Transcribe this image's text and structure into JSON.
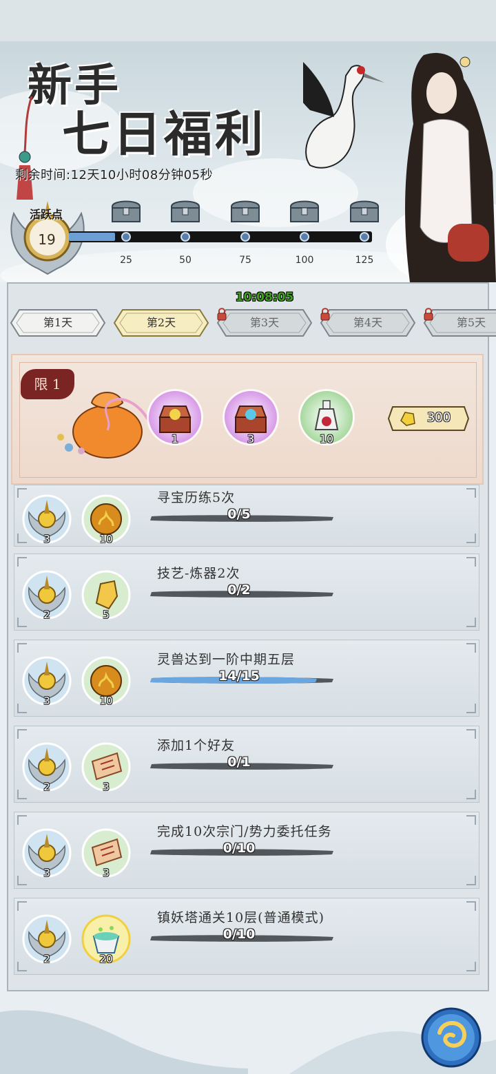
{
  "banner": {
    "title_line1": "新手",
    "title_line2": "七日福利",
    "remaining_time": "剩余时间:12天10小时08分钟05秒",
    "active_label": "活跃点",
    "active_value": "19",
    "progress_fraction": 0.152,
    "milestones": [
      "25",
      "50",
      "75",
      "100",
      "125"
    ]
  },
  "panel": {
    "countdown": "10:08:05",
    "day_tabs": [
      {
        "label": "第1天",
        "state": "normal"
      },
      {
        "label": "第2天",
        "state": "selected"
      },
      {
        "label": "第3天",
        "state": "locked"
      },
      {
        "label": "第4天",
        "state": "locked"
      },
      {
        "label": "第5天",
        "state": "locked"
      }
    ]
  },
  "gift": {
    "limit_label": "限 1",
    "rewards": [
      {
        "icon": "treasure-chest-gold-icon",
        "count": "1"
      },
      {
        "icon": "treasure-chest-blue-icon",
        "count": "3"
      },
      {
        "icon": "red-potion-bottle-icon",
        "count": "10"
      }
    ],
    "price": "300"
  },
  "tasks": [
    {
      "title": "寻宝历练5次",
      "progress": "0/5",
      "fraction": 0,
      "reward1_count": "3",
      "reward2_count": "10",
      "reward2_icon": "fire-orb-icon"
    },
    {
      "title": "技艺-炼器2次",
      "progress": "0/2",
      "fraction": 0,
      "reward1_count": "2",
      "reward2_count": "5",
      "reward2_icon": "gold-ore-icon"
    },
    {
      "title": "灵兽达到一阶中期五层",
      "progress": "14/15",
      "fraction": 0.933,
      "reward1_count": "3",
      "reward2_count": "10",
      "reward2_icon": "fire-orb-icon"
    },
    {
      "title": "添加1个好友",
      "progress": "0/1",
      "fraction": 0,
      "reward1_count": "2",
      "reward2_count": "3",
      "reward2_icon": "scroll-icon"
    },
    {
      "title": "完成10次宗门/势力委托任务",
      "progress": "0/10",
      "fraction": 0,
      "reward1_count": "3",
      "reward2_count": "3",
      "reward2_icon": "scroll-icon"
    },
    {
      "title": "镇妖塔通关10层(普通模式)",
      "progress": "0/10",
      "fraction": 0,
      "reward1_count": "2",
      "reward2_count": "20",
      "reward2_icon": "spirit-bowl-icon"
    }
  ],
  "colors": {
    "accent_green": "#3fa01f",
    "progress_blue": "#6d9fd4",
    "limit_red": "#7a2424"
  }
}
